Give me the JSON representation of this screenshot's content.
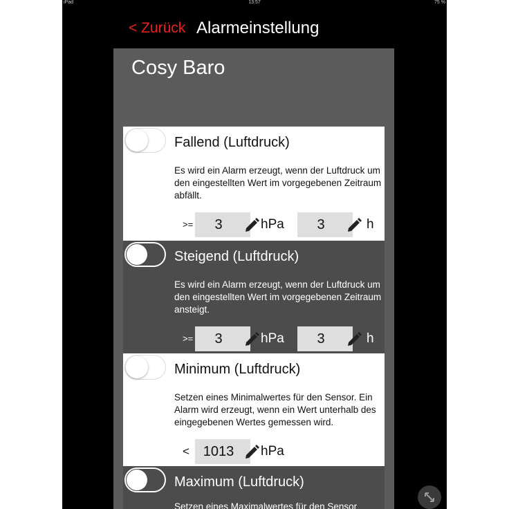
{
  "status": {
    "left": "iPad",
    "time": "13:57",
    "battery": "75 %"
  },
  "nav": {
    "back_label": "< Zurück",
    "title": "Alarmeinstellung"
  },
  "device": {
    "name": "Cosy Baro"
  },
  "alarms": [
    {
      "title": "Fallend (Luftdruck)",
      "description": "Es wird ein Alarm erzeugt, wenn der Luftdruck um den eingestellten Wert im vorgegebenen Zeitraum abfällt.",
      "operator": ">=",
      "value": "3",
      "unit": "hPa",
      "time_value": "3",
      "time_unit": "h",
      "enabled": false
    },
    {
      "title": "Steigend (Luftdruck)",
      "description": "Es wird ein Alarm erzeugt, wenn der Luftdruck um den eingestellten Wert im vorgegebenen Zeitraum ansteigt.",
      "operator": ">=",
      "value": "3",
      "unit": "hPa",
      "time_value": "3",
      "time_unit": "h",
      "enabled": false
    },
    {
      "title": "Minimum (Luftdruck)",
      "description": "Setzen eines Minimalwertes für den Sensor. Ein Alarm wird erzeugt, wenn ein Wert unterhalb des eingegebenen Wertes gemessen wird.",
      "operator": "<",
      "value": "1013",
      "unit": "hPa",
      "enabled": false
    },
    {
      "title": "Maximum (Luftdruck)",
      "description": "Setzen eines Maximalwertes für den Sensor",
      "enabled": false
    }
  ],
  "colors": {
    "accent": "#e8201e",
    "panel": "#5b5b5b",
    "dark_card": "#4c4c4c",
    "input": "#dedede"
  },
  "icons": {
    "edit": "pencil-icon",
    "fullscreen": "resize-icon"
  }
}
